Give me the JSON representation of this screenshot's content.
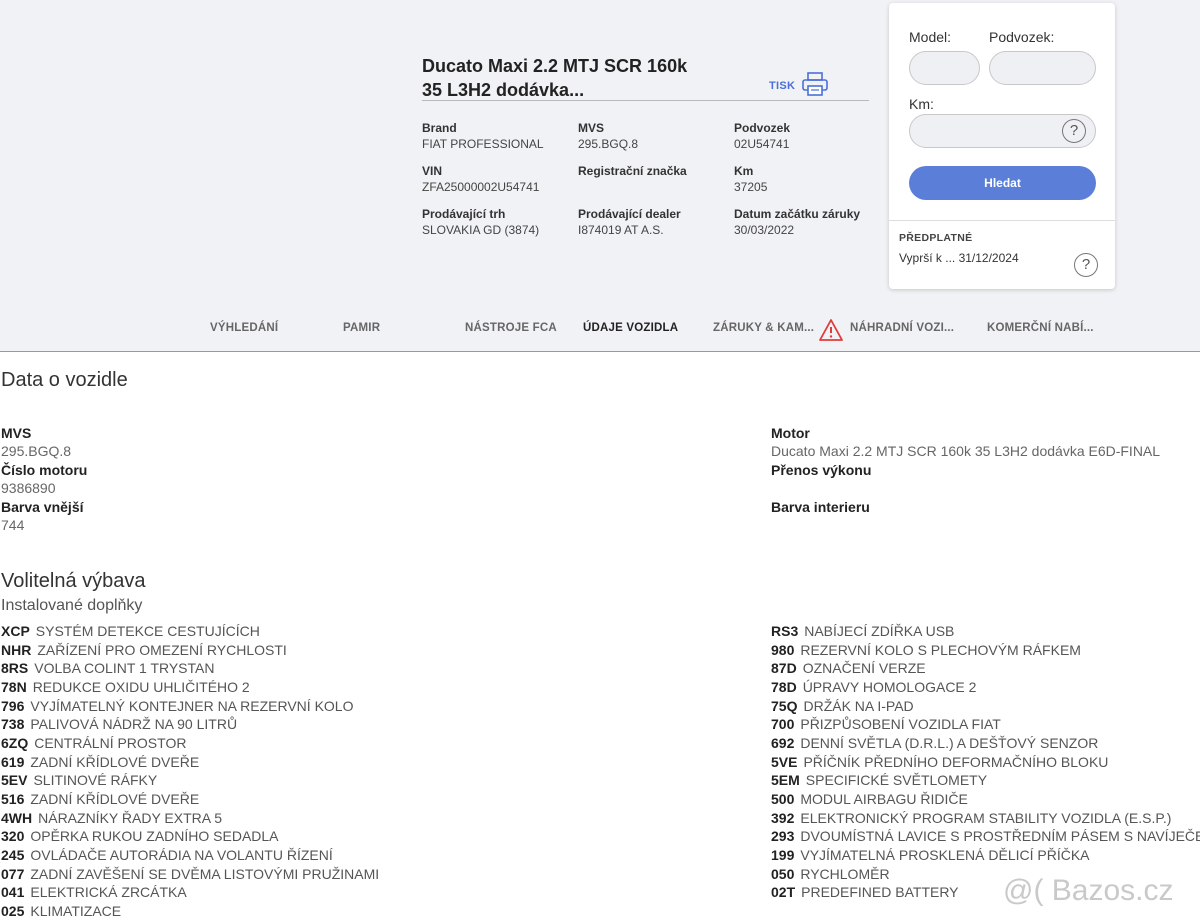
{
  "vehicle": {
    "title_line1": "Ducato Maxi 2.2 MTJ SCR 160k",
    "title_line2": "35 L3H2 dodávka...",
    "print_label": "TISK",
    "info": [
      {
        "key": "Brand",
        "value": "FIAT PROFESSIONAL"
      },
      {
        "key": "MVS",
        "value": "295.BGQ.8"
      },
      {
        "key": "Podvozek",
        "value": "02U54741"
      },
      {
        "key": "VIN",
        "value": "ZFA25000002U54741"
      },
      {
        "key": "Registrační značka",
        "value": ""
      },
      {
        "key": "Km",
        "value": "37205"
      },
      {
        "key": "Prodávající trh",
        "value": "SLOVAKIA GD (3874)"
      },
      {
        "key": "Prodávající dealer",
        "value": "I874019 AT A.S."
      },
      {
        "key": "Datum začátku záruky",
        "value": "30/03/2022"
      }
    ]
  },
  "tabs": [
    "VÝHLEDÁNÍ",
    "PAMIR",
    "NÁSTROJE FCA",
    "ÚDAJE VOZIDLA",
    "ZÁRUKY & KAM...",
    "NÁHRADNÍ VOZI...",
    "KOMERČNÍ NABÍ..."
  ],
  "search": {
    "model_label": "Model:",
    "chassis_label": "Podvozek:",
    "km_label": "Km:",
    "help_symbol": "?",
    "button": "Hledat",
    "subscription_title": "PŘEDPLATNÉ",
    "subscription_value": "Vyprší k ... 31/12/2024"
  },
  "vehicle_data": {
    "title": "Data o vozidle",
    "left": [
      {
        "key": "MVS",
        "value": "295.BGQ.8"
      },
      {
        "key": "Číslo motoru",
        "value": "9386890"
      },
      {
        "key": "Barva vnější",
        "value": "744"
      }
    ],
    "right": [
      {
        "key": "Motor",
        "value": "Ducato Maxi 2.2 MTJ SCR 160k 35 L3H2 dodávka E6D-FINAL"
      },
      {
        "key": "Přenos výkonu",
        "value": ""
      },
      {
        "key": "Barva interieru",
        "value": ""
      }
    ]
  },
  "optional": {
    "title": "Volitelná výbava",
    "subtitle": "Instalované doplňky",
    "left": [
      {
        "code": "XCP",
        "desc": "SYSTÉM DETEKCE CESTUJÍCÍCH"
      },
      {
        "code": "NHR",
        "desc": "ZAŘÍZENÍ PRO OMEZENÍ RYCHLOSTI"
      },
      {
        "code": "8RS",
        "desc": "VOLBA COLINT 1 TRYSTAN"
      },
      {
        "code": "78N",
        "desc": "REDUKCE OXIDU UHLIČITÉHO 2"
      },
      {
        "code": "796",
        "desc": "VYJÍMATELNÝ KONTEJNER NA REZERVNÍ KOLO"
      },
      {
        "code": "738",
        "desc": "PALIVOVÁ NÁDRŽ NA 90 LITRŮ"
      },
      {
        "code": "6ZQ",
        "desc": "CENTRÁLNÍ PROSTOR"
      },
      {
        "code": "619",
        "desc": "ZADNÍ KŘÍDLOVÉ DVEŘE"
      },
      {
        "code": "5EV",
        "desc": "SLITINOVÉ RÁFKY"
      },
      {
        "code": "516",
        "desc": "ZADNÍ KŘÍDLOVÉ DVEŘE"
      },
      {
        "code": "4WH",
        "desc": "NÁRAZNÍKY ŘADY EXTRA 5"
      },
      {
        "code": "320",
        "desc": "OPĚRKA RUKOU ZADNÍHO SEDADLA"
      },
      {
        "code": "245",
        "desc": "OVLÁDAČE AUTORÁDIA NA VOLANTU ŘÍZENÍ"
      },
      {
        "code": "077",
        "desc": "ZADNÍ ZAVĚŠENÍ SE DVĚMA LISTOVÝMI PRUŽINAMI"
      },
      {
        "code": "041",
        "desc": "ELEKTRICKÁ ZRCÁTKA"
      },
      {
        "code": "025",
        "desc": "KLIMATIZACE"
      }
    ],
    "right": [
      {
        "code": "RS3",
        "desc": "NABÍJECÍ ZDÍŘKA USB"
      },
      {
        "code": "980",
        "desc": "REZERVNÍ KOLO S PLECHOVÝM RÁFKEM"
      },
      {
        "code": "87D",
        "desc": "OZNAČENÍ VERZE"
      },
      {
        "code": "78D",
        "desc": "ÚPRAVY HOMOLOGACE 2"
      },
      {
        "code": "75Q",
        "desc": "DRŽÁK NA I-PAD"
      },
      {
        "code": "700",
        "desc": "PŘIZPŮSOBENÍ VOZIDLA FIAT"
      },
      {
        "code": "692",
        "desc": "DENNÍ SVĚTLA (D.R.L.) A DEŠŤOVÝ SENZOR"
      },
      {
        "code": "5VE",
        "desc": "PŘÍČNÍK PŘEDNÍHO DEFORMAČNÍHO BLOKU"
      },
      {
        "code": "5EM",
        "desc": "SPECIFICKÉ SVĚTLOMETY"
      },
      {
        "code": "500",
        "desc": "MODUL AIRBAGU ŘIDIČE"
      },
      {
        "code": "392",
        "desc": "ELEKTRONICKÝ PROGRAM STABILITY VOZIDLA (E.S.P.)"
      },
      {
        "code": "293",
        "desc": "DVOUMÍSTNÁ LAVICE S PROSTŘEDNÍM PÁSEM S NAVÍJEČEM"
      },
      {
        "code": "199",
        "desc": "VYJÍMATELNÁ PROSKLENÁ DĚLICÍ PŘÍČKA"
      },
      {
        "code": "050",
        "desc": "RYCHLOMĚR"
      },
      {
        "code": "02T",
        "desc": "PREDEFINED BATTERY"
      }
    ]
  },
  "watermark": "@( Bazos.cz",
  "icons": {
    "print": "printer-icon",
    "warning": "warning-triangle-icon",
    "help": "help-circle-icon"
  },
  "colors": {
    "accent": "#5b7fd9",
    "link": "#4a6fd8",
    "warning": "#e03b3b",
    "band": "#f1f2f5"
  }
}
